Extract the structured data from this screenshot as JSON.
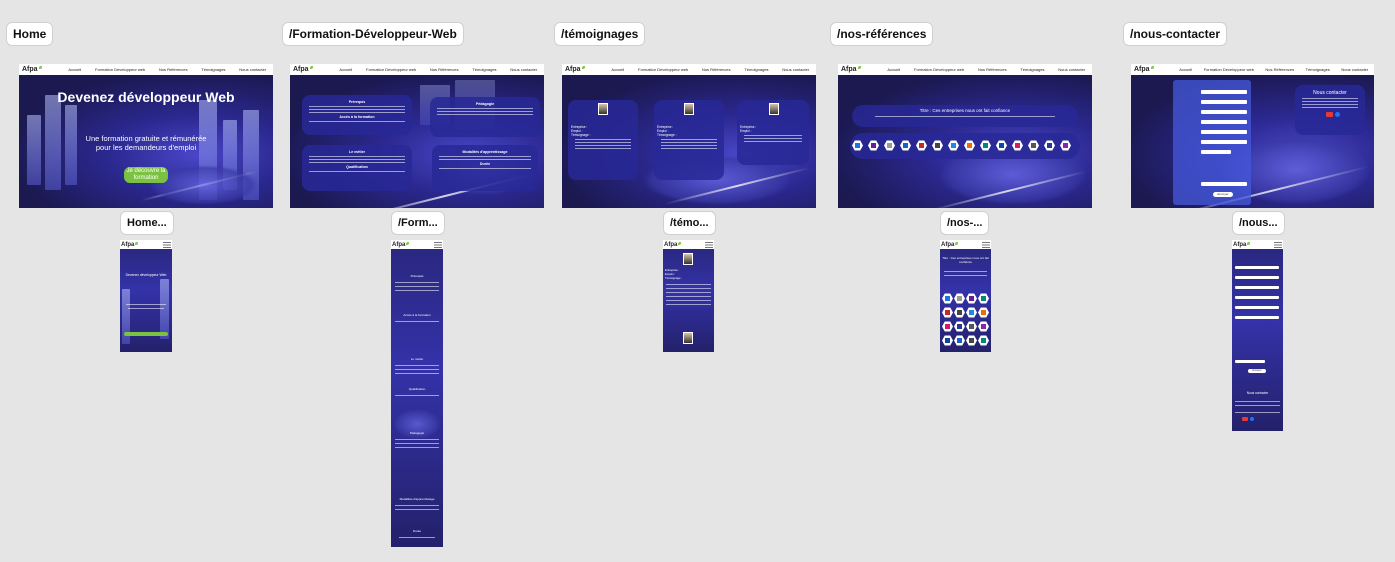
{
  "frames": {
    "desktop": [
      {
        "id": "home",
        "label": "Home"
      },
      {
        "id": "formation",
        "label": "/Formation-Développeur-Web"
      },
      {
        "id": "temoignages",
        "label": "/témoignages"
      },
      {
        "id": "references",
        "label": "/nos-références"
      },
      {
        "id": "contact",
        "label": "/nous-contacter"
      }
    ],
    "mobile": [
      {
        "id": "home",
        "label": "Home..."
      },
      {
        "id": "formation",
        "label": "/Form..."
      },
      {
        "id": "temoignages",
        "label": "/témo..."
      },
      {
        "id": "references",
        "label": "/nos-..."
      },
      {
        "id": "contact",
        "label": "/nous..."
      }
    ]
  },
  "site": {
    "logo": "Afpa",
    "nav": [
      "Accueil",
      "Formation Développeur web",
      "Nos Références",
      "Témoignages",
      "Nous contacter"
    ]
  },
  "home": {
    "title": "Devenez développeur Web",
    "subtitle_line1": "Une formation gratuite et rémunérée",
    "subtitle_line2": "pour les demandeurs d'emploi",
    "cta_line1": "Je découvre la",
    "cta_line2": "formation",
    "mobile_title": "Devenez développeur Web"
  },
  "formation": {
    "sections": [
      "Prérequis",
      "Accès à la formation",
      "Le métier",
      "Qualification",
      "Pédagogie",
      "Modalités d'apprentissage",
      "Durée"
    ]
  },
  "temoignages": {
    "labels": [
      "Entreprise :",
      "Emploi :",
      "Témoignage :"
    ]
  },
  "references": {
    "title": "Titre : Ces entreprises nous ont fait confiance"
  },
  "contact": {
    "title": "Nous contacter",
    "submit": "Envoyer",
    "mobile_title": "Nous contacter"
  },
  "colors": {
    "accent": "#7cc242",
    "scene": "#2b2890",
    "canvas": "#e5e5e5"
  }
}
